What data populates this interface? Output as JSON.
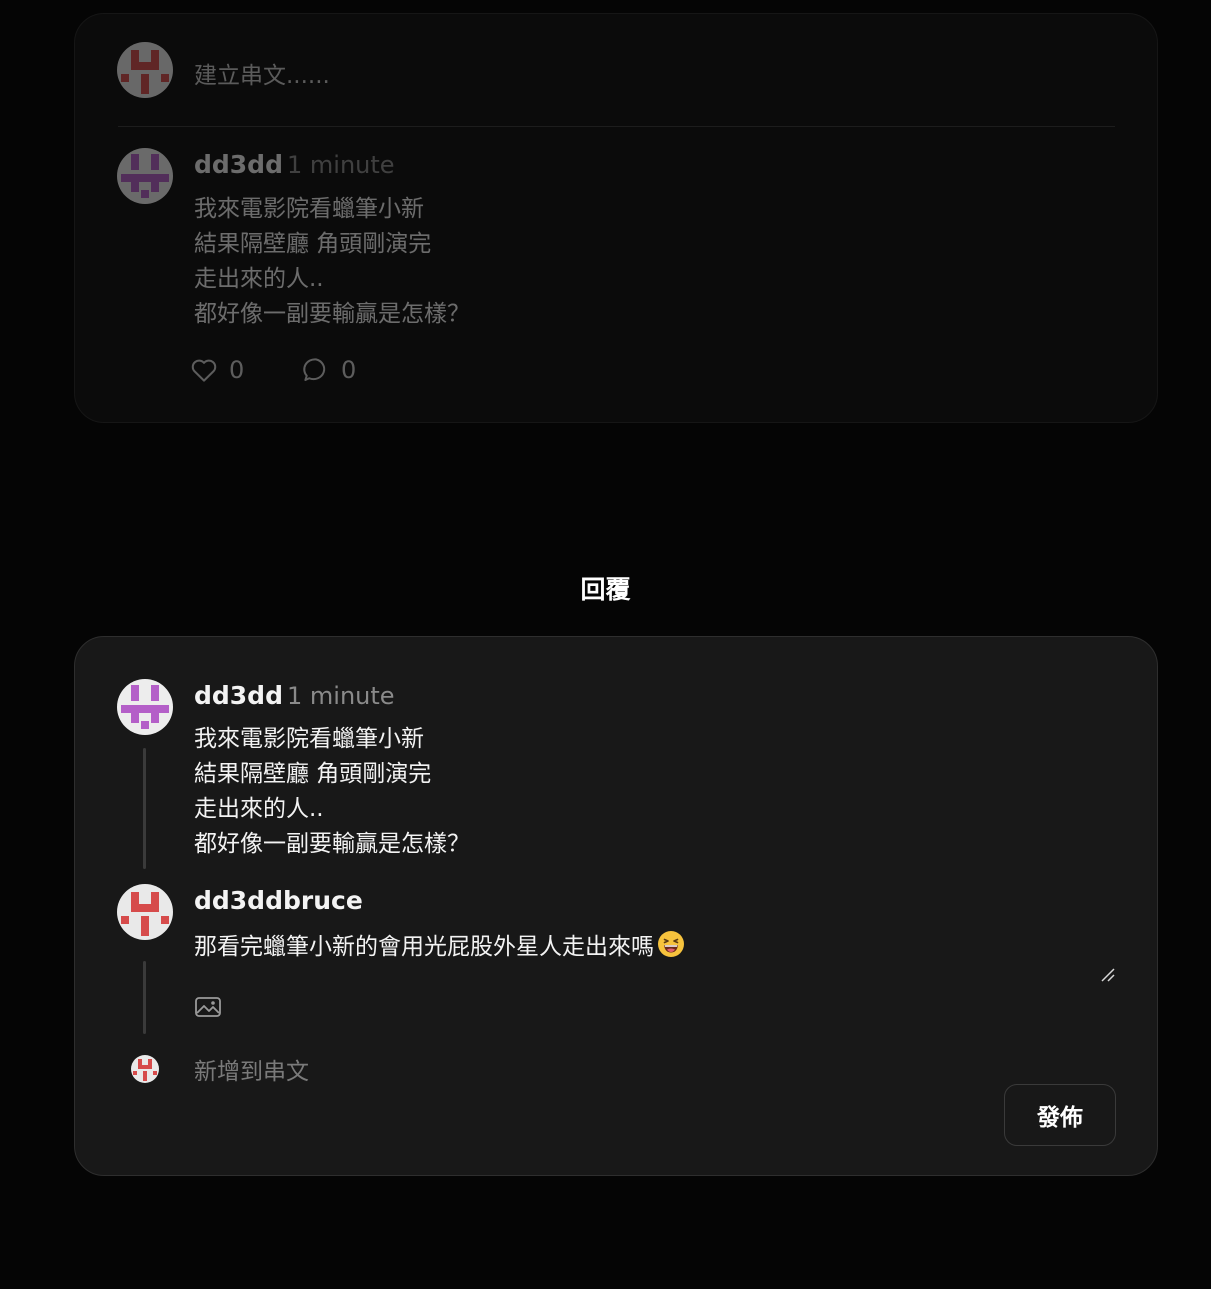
{
  "background_feed": {
    "compose_placeholder": "建立串文......",
    "post": {
      "author": "dd3dd",
      "time": "1 minute",
      "lines": [
        "我來電影院看蠟筆小新",
        "結果隔壁廳 角頭剛演完",
        "走出來的人..",
        "都好像一副要輸贏是怎樣？"
      ],
      "like_count": "0",
      "comment_count": "0"
    }
  },
  "modal": {
    "title": "回覆",
    "original_post": {
      "author": "dd3dd",
      "time": "1 minute",
      "lines": [
        "我來電影院看蠟筆小新",
        "結果隔壁廳 角頭剛演完",
        "走出來的人..",
        "都好像一副要輸贏是怎樣？"
      ]
    },
    "reply": {
      "author": "dd3ddbruce",
      "text": "那看完蠟筆小新的會用光屁股外星人走出來嗎",
      "emoji": "laughing-face-emoji"
    },
    "add_to_thread_label": "新增到串文",
    "post_button_label": "發佈"
  },
  "colors": {
    "page_bg": "#050505",
    "modal_bg": "#181818",
    "avatar_purple": "#b45fc8",
    "avatar_red": "#d64b4b"
  }
}
